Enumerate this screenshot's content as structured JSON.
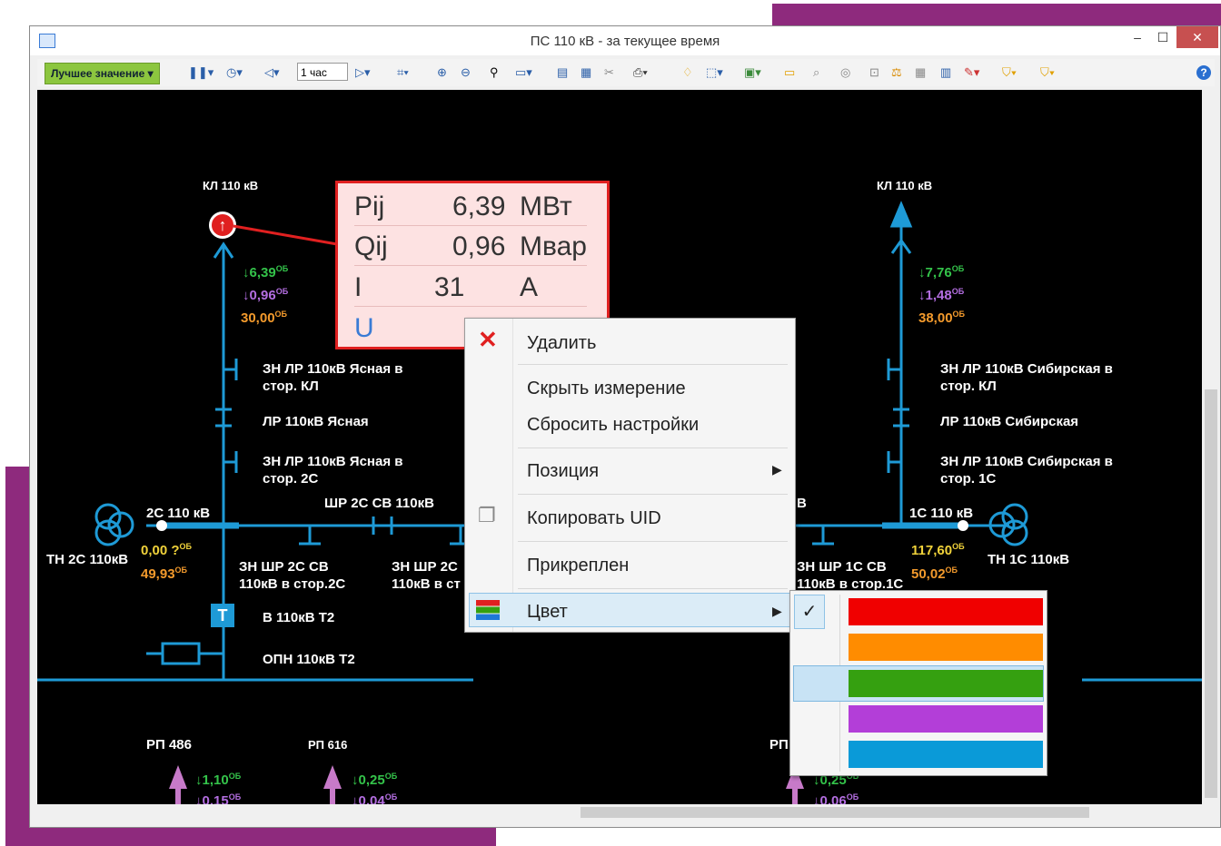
{
  "window": {
    "title": "ПС 110 кВ - за текущее время",
    "min": "–",
    "max": "☐",
    "close": "✕"
  },
  "toolbar": {
    "best_value": "Лучшее значение",
    "hour": "1 час",
    "help": "?"
  },
  "diagram": {
    "kl_left": "КЛ 110 кВ",
    "kl_right": "КЛ 110 кВ",
    "left_p": "↓6,39",
    "left_q": "↓0,96",
    "left_i": "30,00",
    "os": "ОБ",
    "right_p": "↓7,76",
    "right_q": "↓1,48",
    "right_i": "38,00",
    "zn_lr_yasnaya_kl": "ЗН ЛР 110кВ Ясная в\nстор. КЛ",
    "lr_yasnaya": "ЛР 110кВ Ясная",
    "zn_lr_yasnaya_2c": "ЗН ЛР 110кВ Ясная в\nстор. 2С",
    "zn_lr_sib_kl": "ЗН ЛР 110кВ Сибирская в\nстор. КЛ",
    "lr_sib": "ЛР 110кВ Сибирская",
    "zn_lr_sib_1c": "ЗН ЛР 110кВ Сибирская в\nстор. 1С",
    "bus_2c": "2С 110 кВ",
    "bus_1c": "1С 110 кВ",
    "shr_2c": "ШР 2С СВ 110кВ",
    "shr_1c_tail": "В",
    "tn_2c": "ТН 2С 110кВ",
    "tn_1c": "ТН 1С 110кВ",
    "u_2c": "0,00 ?",
    "f_2c": "49,93",
    "u_1c": "117,60",
    "f_1c": "50,02",
    "zn_shr_2c": "ЗН ШР 2С СВ\n110кВ в стор.2С",
    "zn_shr_2c_b": "ЗН ШР 2С\n110кВ в ст",
    "zn_shr_1c": "ЗН ШР 1С СВ\n110кВ в стор.1С",
    "t_badge": "T",
    "v_t2": "В 110кВ Т2",
    "opn_t2": "ОПН 110кВ Т2",
    "rp486": "РП 486",
    "rp616": "РП 616",
    "rp_right": "РП",
    "rp486_p": "↓1,10",
    "rp486_q": "↓0,15",
    "rp616_p": "↓0,25",
    "rp616_q": "↓0,04",
    "rpr_p": "↓0,25",
    "rpr_q": "↓0,06"
  },
  "callout": {
    "rows": [
      {
        "name": "Pij",
        "value": "6,39",
        "unit": "МВт"
      },
      {
        "name": "Qij",
        "value": "0,96",
        "unit": "Мвар"
      },
      {
        "name": "I",
        "value": "31",
        "unit": "А"
      },
      {
        "name": "U",
        "value": "",
        "unit": ""
      }
    ]
  },
  "context_menu": {
    "delete": "Удалить",
    "hide": "Скрыть измерение",
    "reset": "Сбросить настройки",
    "position": "Позиция",
    "copy_uid": "Копировать UID",
    "pinned": "Прикреплен",
    "color": "Цвет"
  },
  "color_submenu": {
    "swatches": [
      "#f00000",
      "#ff8c00",
      "#35a010",
      "#b33ed8",
      "#0a9ad8"
    ],
    "checked_index": 0,
    "hovered_index": 2
  }
}
